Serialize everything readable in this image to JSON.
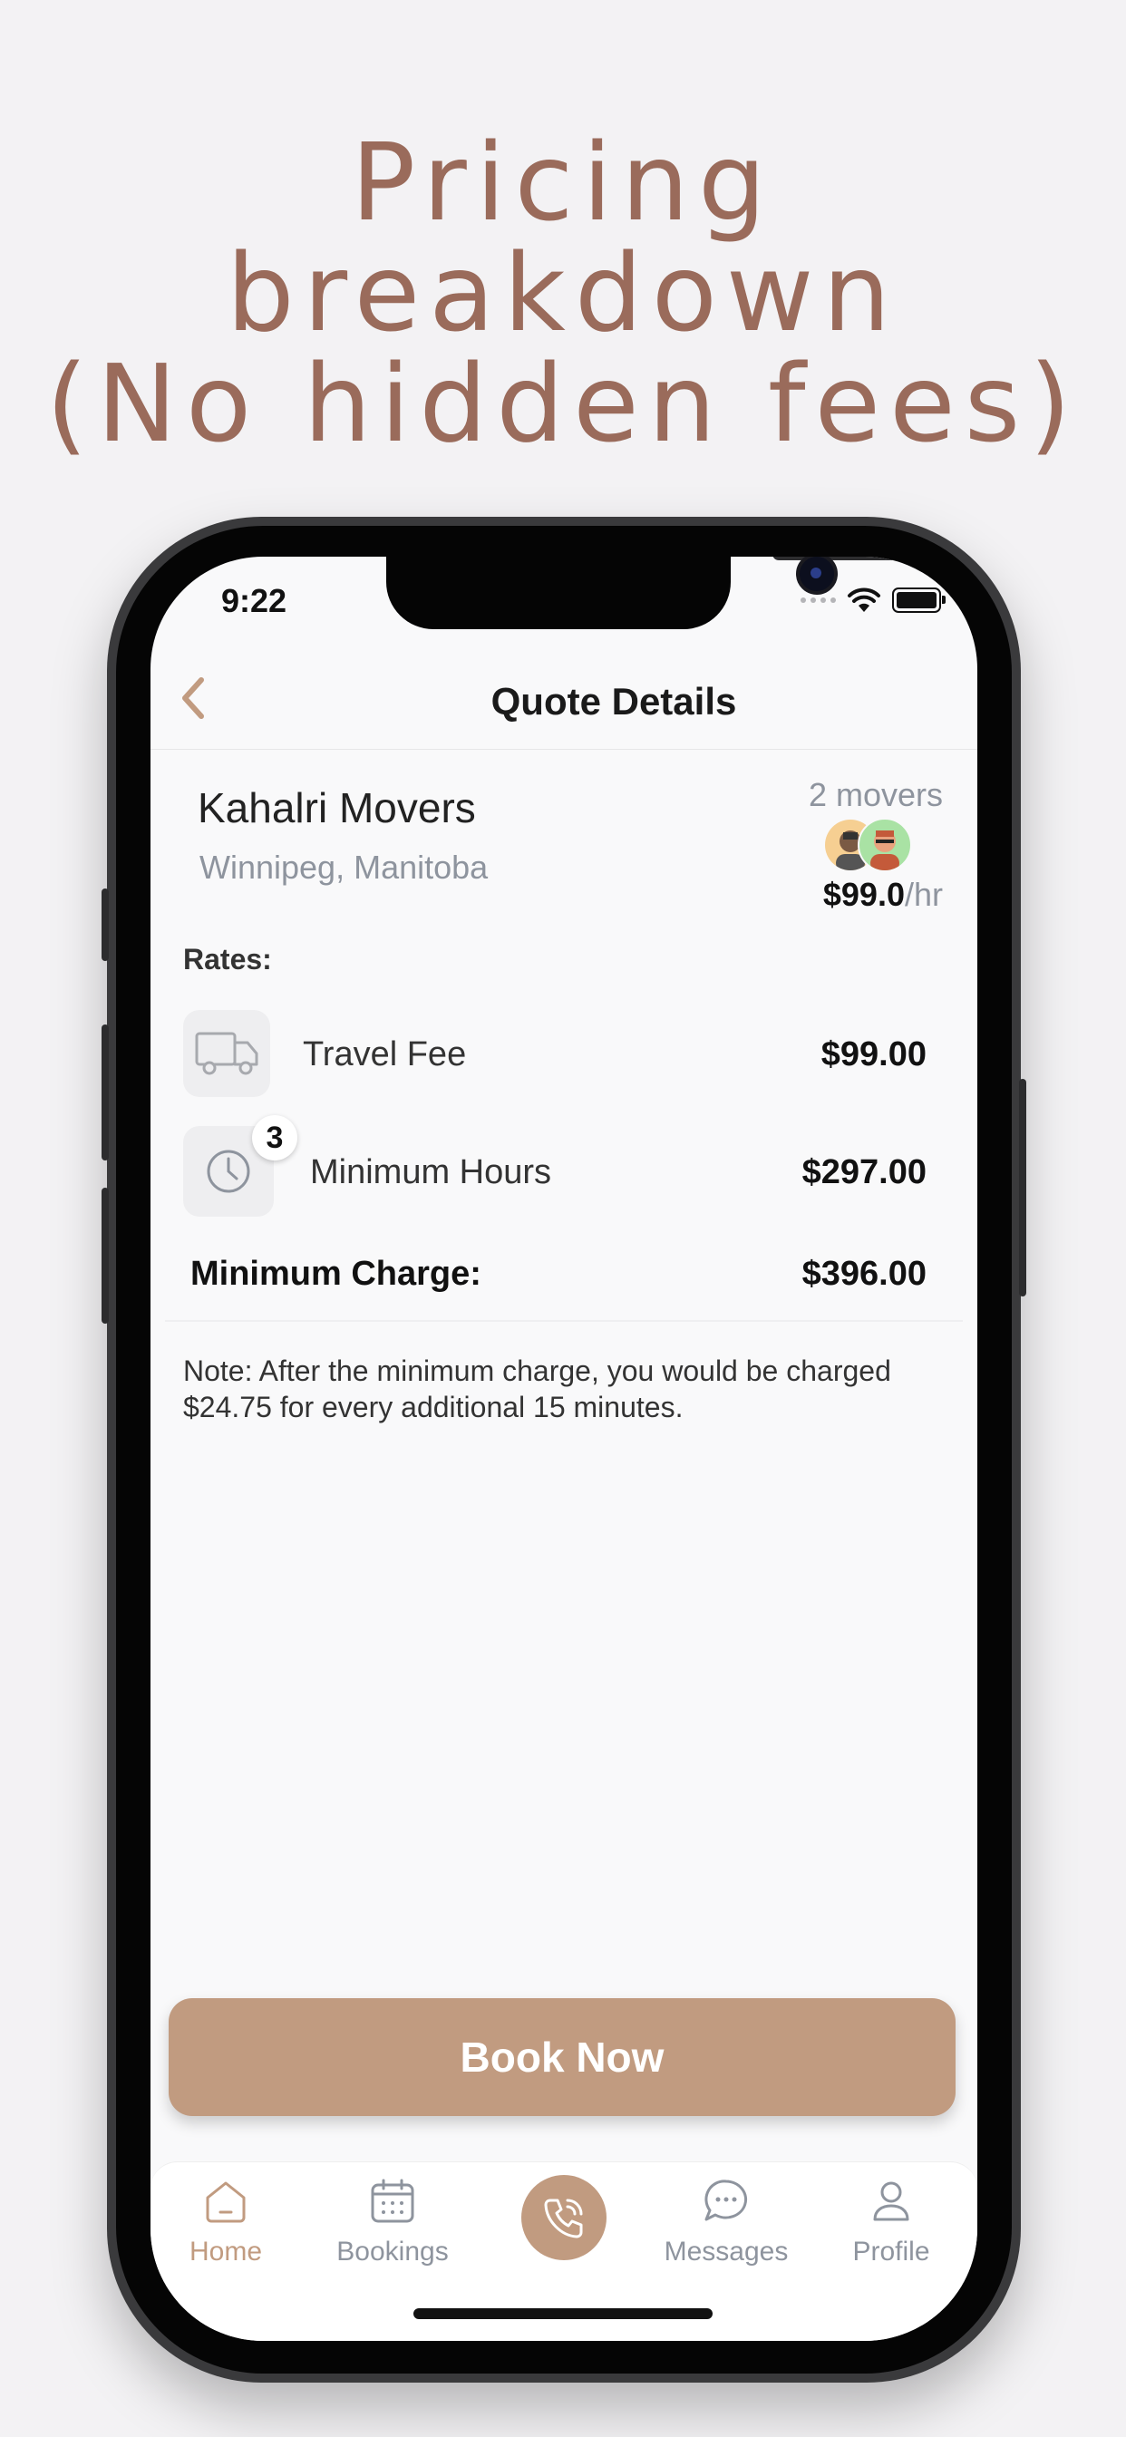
{
  "headline": {
    "line1": "Pricing breakdown",
    "line2": "(No hidden fees)"
  },
  "status_bar": {
    "time": "9:22"
  },
  "nav": {
    "title": "Quote Details"
  },
  "mover": {
    "company": "Kahalri Movers",
    "location": "Winnipeg, Manitoba",
    "movers_count": "2 movers",
    "rate_value": "$99.0",
    "rate_unit": "/hr"
  },
  "rates": {
    "label": "Rates:",
    "items": [
      {
        "label": "Travel Fee",
        "amount": "$99.00",
        "icon": "truck-icon"
      },
      {
        "label": "Minimum Hours",
        "amount": "$297.00",
        "icon": "clock-icon",
        "badge": "3"
      }
    ],
    "minimum_charge_label": "Minimum Charge:",
    "minimum_charge_amount": "$396.00"
  },
  "note": "Note: After the minimum charge, you would be charged $24.75 for every additional 15 minutes.",
  "book_button": "Book Now",
  "tabs": [
    {
      "label": "Home",
      "icon": "home-icon",
      "active": true
    },
    {
      "label": "Bookings",
      "icon": "calendar-icon",
      "active": false
    },
    {
      "label": "",
      "icon": "phone-call-icon",
      "active": false
    },
    {
      "label": "Messages",
      "icon": "chat-bubble-icon",
      "active": false
    },
    {
      "label": "Profile",
      "icon": "person-icon",
      "active": false
    }
  ],
  "colors": {
    "accent": "#c19b80",
    "headline": "#9a6b5b",
    "muted": "#8e949e",
    "background": "#f3f2f4"
  }
}
